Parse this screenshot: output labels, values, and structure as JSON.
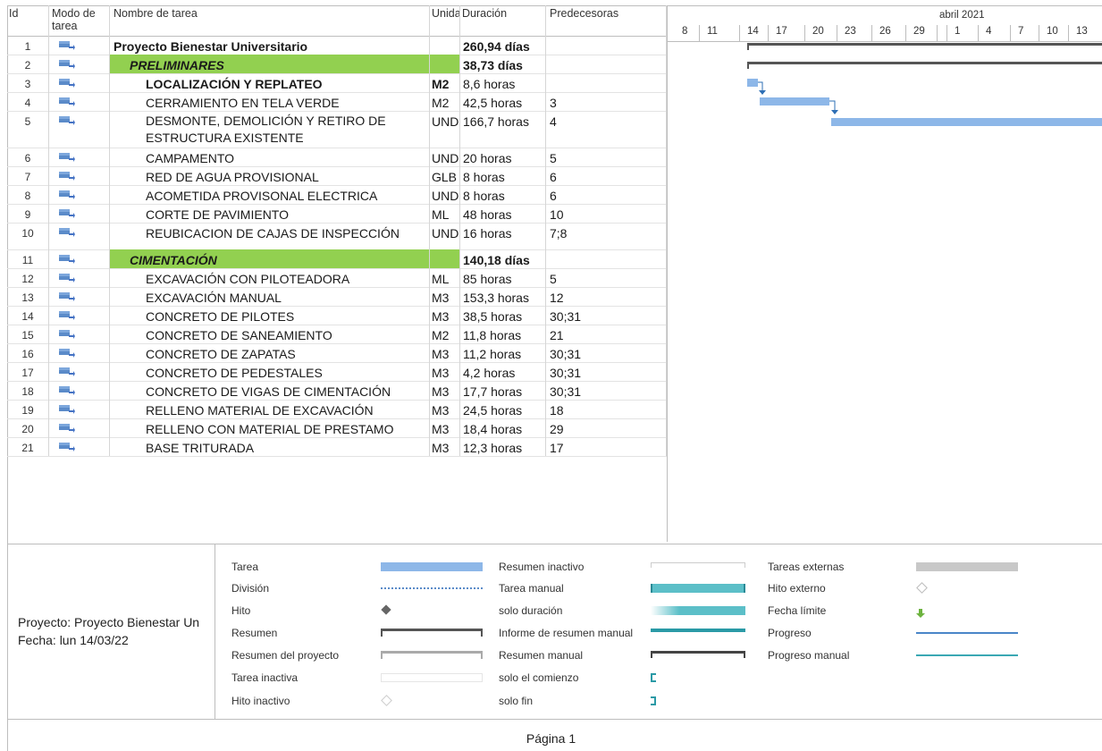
{
  "headers": {
    "id": "Id",
    "mode": "Modo de tarea",
    "name": "Nombre de tarea",
    "unit": "Unidad",
    "duration": "Duración",
    "predecessors": "Predecesoras"
  },
  "tasks": [
    {
      "id": "1",
      "name": "Proyecto Bienestar Universitario",
      "unit": "",
      "duration": "260,94 días",
      "pred": ""
    },
    {
      "id": "2",
      "name": "PRELIMINARES",
      "unit": "",
      "duration": "38,73 días",
      "pred": ""
    },
    {
      "id": "3",
      "name": "LOCALIZACIÓN Y REPLATEO",
      "unit": "M2",
      "duration": "8,6 horas",
      "pred": ""
    },
    {
      "id": "4",
      "name": "CERRAMIENTO EN TELA VERDE",
      "unit": "M2",
      "duration": "42,5 horas",
      "pred": "3"
    },
    {
      "id": "5",
      "name": "DESMONTE, DEMOLICIÓN Y RETIRO DE",
      "name2": "ESTRUCTURA EXISTENTE",
      "unit": "UND",
      "duration": "166,7 horas",
      "pred": "4"
    },
    {
      "id": "6",
      "name": "CAMPAMENTO",
      "unit": "UND",
      "duration": "20 horas",
      "pred": "5"
    },
    {
      "id": "7",
      "name": "RED DE AGUA PROVISIONAL",
      "unit": "GLB",
      "duration": "8 horas",
      "pred": "6"
    },
    {
      "id": "8",
      "name": "ACOMETIDA PROVISONAL ELECTRICA",
      "unit": "UND",
      "duration": "8 horas",
      "pred": "6"
    },
    {
      "id": "9",
      "name": "CORTE DE PAVIMIENTO",
      "unit": "ML",
      "duration": "48 horas",
      "pred": "10"
    },
    {
      "id": "10",
      "name": "REUBICACION DE CAJAS DE INSPECCIÓN",
      "unit": "UND",
      "duration": "16 horas",
      "pred": "7;8"
    },
    {
      "id": "11",
      "name": "CIMENTACIÓN",
      "unit": "",
      "duration": "140,18 días",
      "pred": ""
    },
    {
      "id": "12",
      "name": "EXCAVACIÓN CON PILOTEADORA",
      "unit": "ML",
      "duration": "85 horas",
      "pred": "5"
    },
    {
      "id": "13",
      "name": "EXCAVACIÓN MANUAL",
      "unit": "M3",
      "duration": "153,3 horas",
      "pred": "12"
    },
    {
      "id": "14",
      "name": "CONCRETO DE PILOTES",
      "unit": "M3",
      "duration": "38,5 horas",
      "pred": "30;31"
    },
    {
      "id": "15",
      "name": "CONCRETO DE SANEAMIENTO",
      "unit": "M2",
      "duration": "11,8 horas",
      "pred": "21"
    },
    {
      "id": "16",
      "name": "CONCRETO DE ZAPATAS",
      "unit": "M3",
      "duration": "11,2 horas",
      "pred": "30;31"
    },
    {
      "id": "17",
      "name": "CONCRETO DE PEDESTALES",
      "unit": "M3",
      "duration": "4,2 horas",
      "pred": "30;31"
    },
    {
      "id": "18",
      "name": "CONCRETO DE VIGAS DE CIMENTACIÓN",
      "unit": "M3",
      "duration": "17,7 horas",
      "pred": "30;31"
    },
    {
      "id": "19",
      "name": "RELLENO MATERIAL DE EXCAVACIÓN",
      "unit": "M3",
      "duration": "24,5 horas",
      "pred": "18"
    },
    {
      "id": "20",
      "name": "RELLENO CON MATERIAL DE PRESTAMO",
      "unit": "M3",
      "duration": "18,4 horas",
      "pred": "29"
    },
    {
      "id": "21",
      "name": "BASE TRITURADA",
      "unit": "M3",
      "duration": "12,3 horas",
      "pred": "17"
    }
  ],
  "timescale": {
    "month": "abril 2021",
    "days": [
      "8",
      "11",
      "14",
      "17",
      "20",
      "23",
      "26",
      "29",
      "1",
      "4",
      "7",
      "10",
      "13"
    ]
  },
  "legend": {
    "project_line": "Proyecto: Proyecto Bienestar Un",
    "date_line": "Fecha: lun 14/03/22",
    "col1": [
      "Tarea",
      "División",
      "Hito",
      "Resumen",
      "Resumen del proyecto",
      "Tarea inactiva",
      "Hito inactivo"
    ],
    "col2": [
      "Resumen inactivo",
      "Tarea manual",
      "solo duración",
      "Informe de resumen manual",
      "Resumen manual",
      "solo el comienzo",
      "solo fin"
    ],
    "col3": [
      "Tareas externas",
      "Hito externo",
      "Fecha límite",
      "Progreso",
      "Progreso manual"
    ]
  },
  "footer": "Página 1",
  "colors": {
    "summary_green": "#92d050",
    "task_bar": "#8db7e8",
    "summary_bar": "#555555",
    "manual_teal": "#5cbfc8"
  }
}
